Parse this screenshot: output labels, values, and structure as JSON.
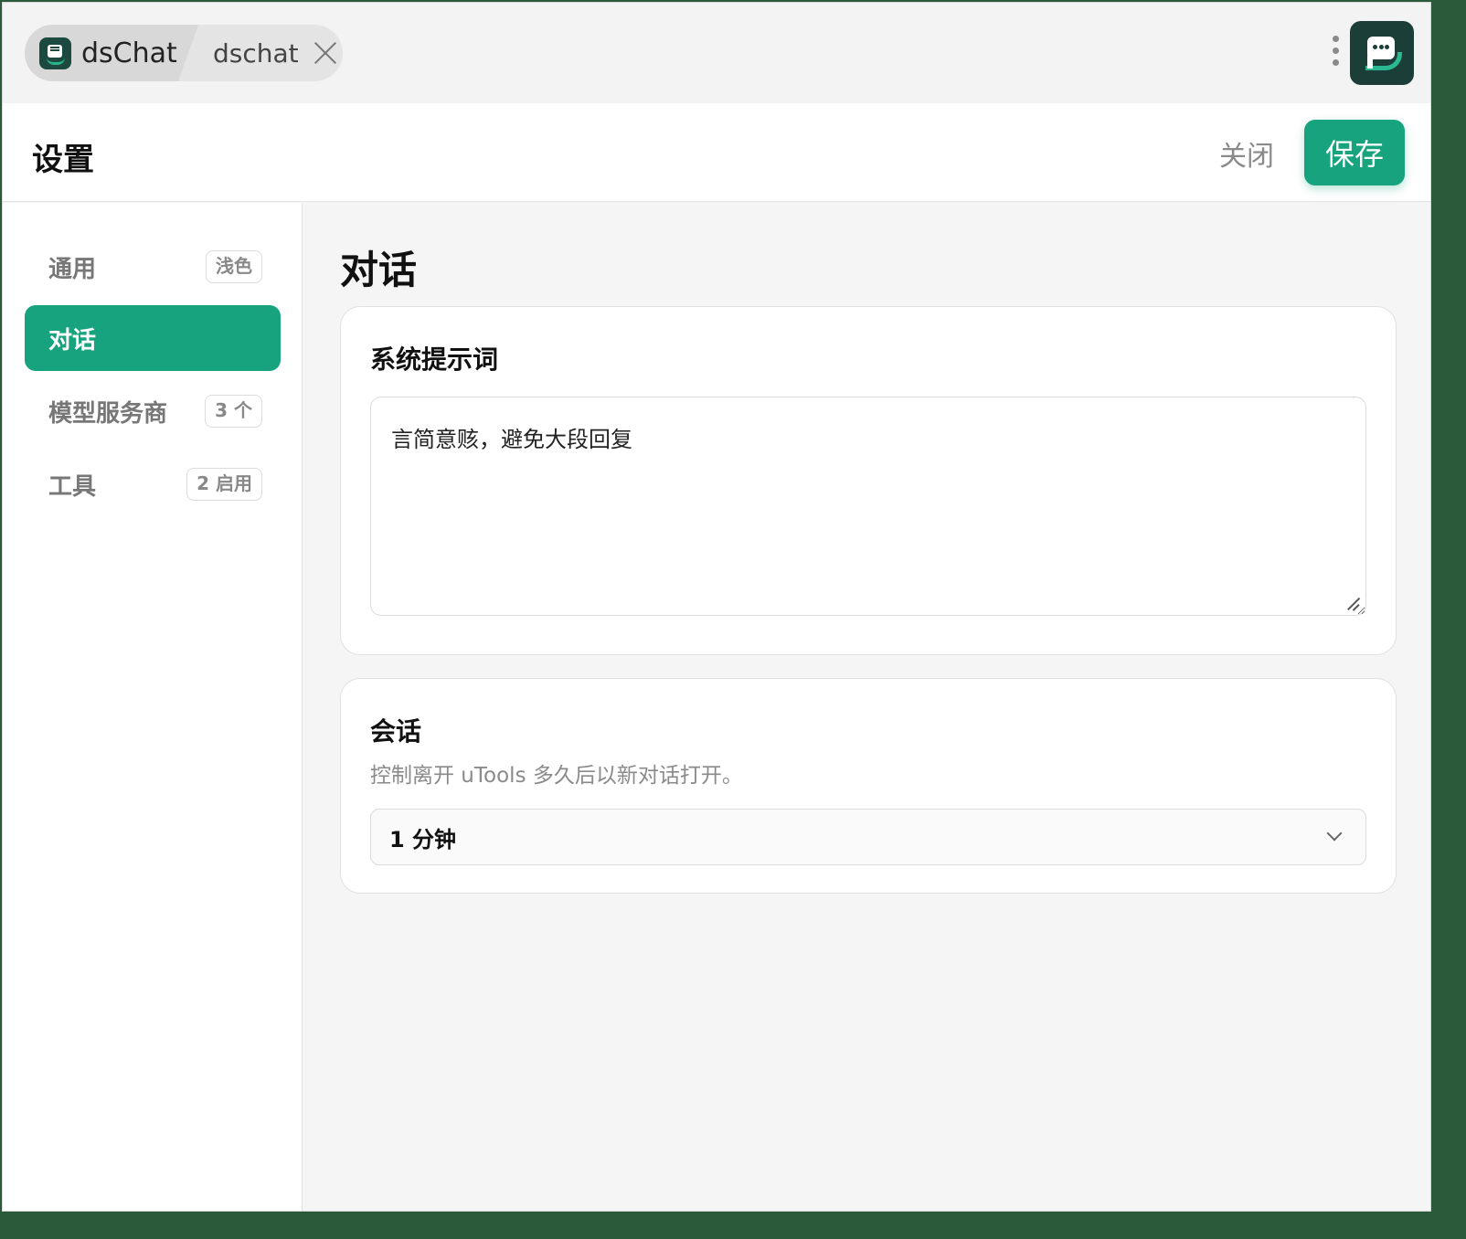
{
  "titlebar": {
    "app_name": "dsChat",
    "tab_label": "dschat",
    "close_tab_icon": "close-icon",
    "menu_icon": "more-vertical-icon",
    "logo_icon": "dschat-logo-icon"
  },
  "header": {
    "title": "设置",
    "close_label": "关闭",
    "save_label": "保存"
  },
  "sidebar": {
    "items": [
      {
        "label": "通用",
        "badge": "浅色",
        "active": false
      },
      {
        "label": "对话",
        "badge": "",
        "active": true
      },
      {
        "label": "模型服务商",
        "badge": "3 个",
        "active": false
      },
      {
        "label": "工具",
        "badge": "2 启用",
        "active": false
      }
    ]
  },
  "main": {
    "section_title": "对话",
    "system_prompt": {
      "title": "系统提示词",
      "value": "言简意赅，避免大段回复"
    },
    "session": {
      "title": "会话",
      "description": "控制离开 uTools 多久后以新对话打开。",
      "selected": "1 分钟"
    }
  },
  "colors": {
    "accent": "#17a37e",
    "logo_bg": "#1b3e39"
  }
}
